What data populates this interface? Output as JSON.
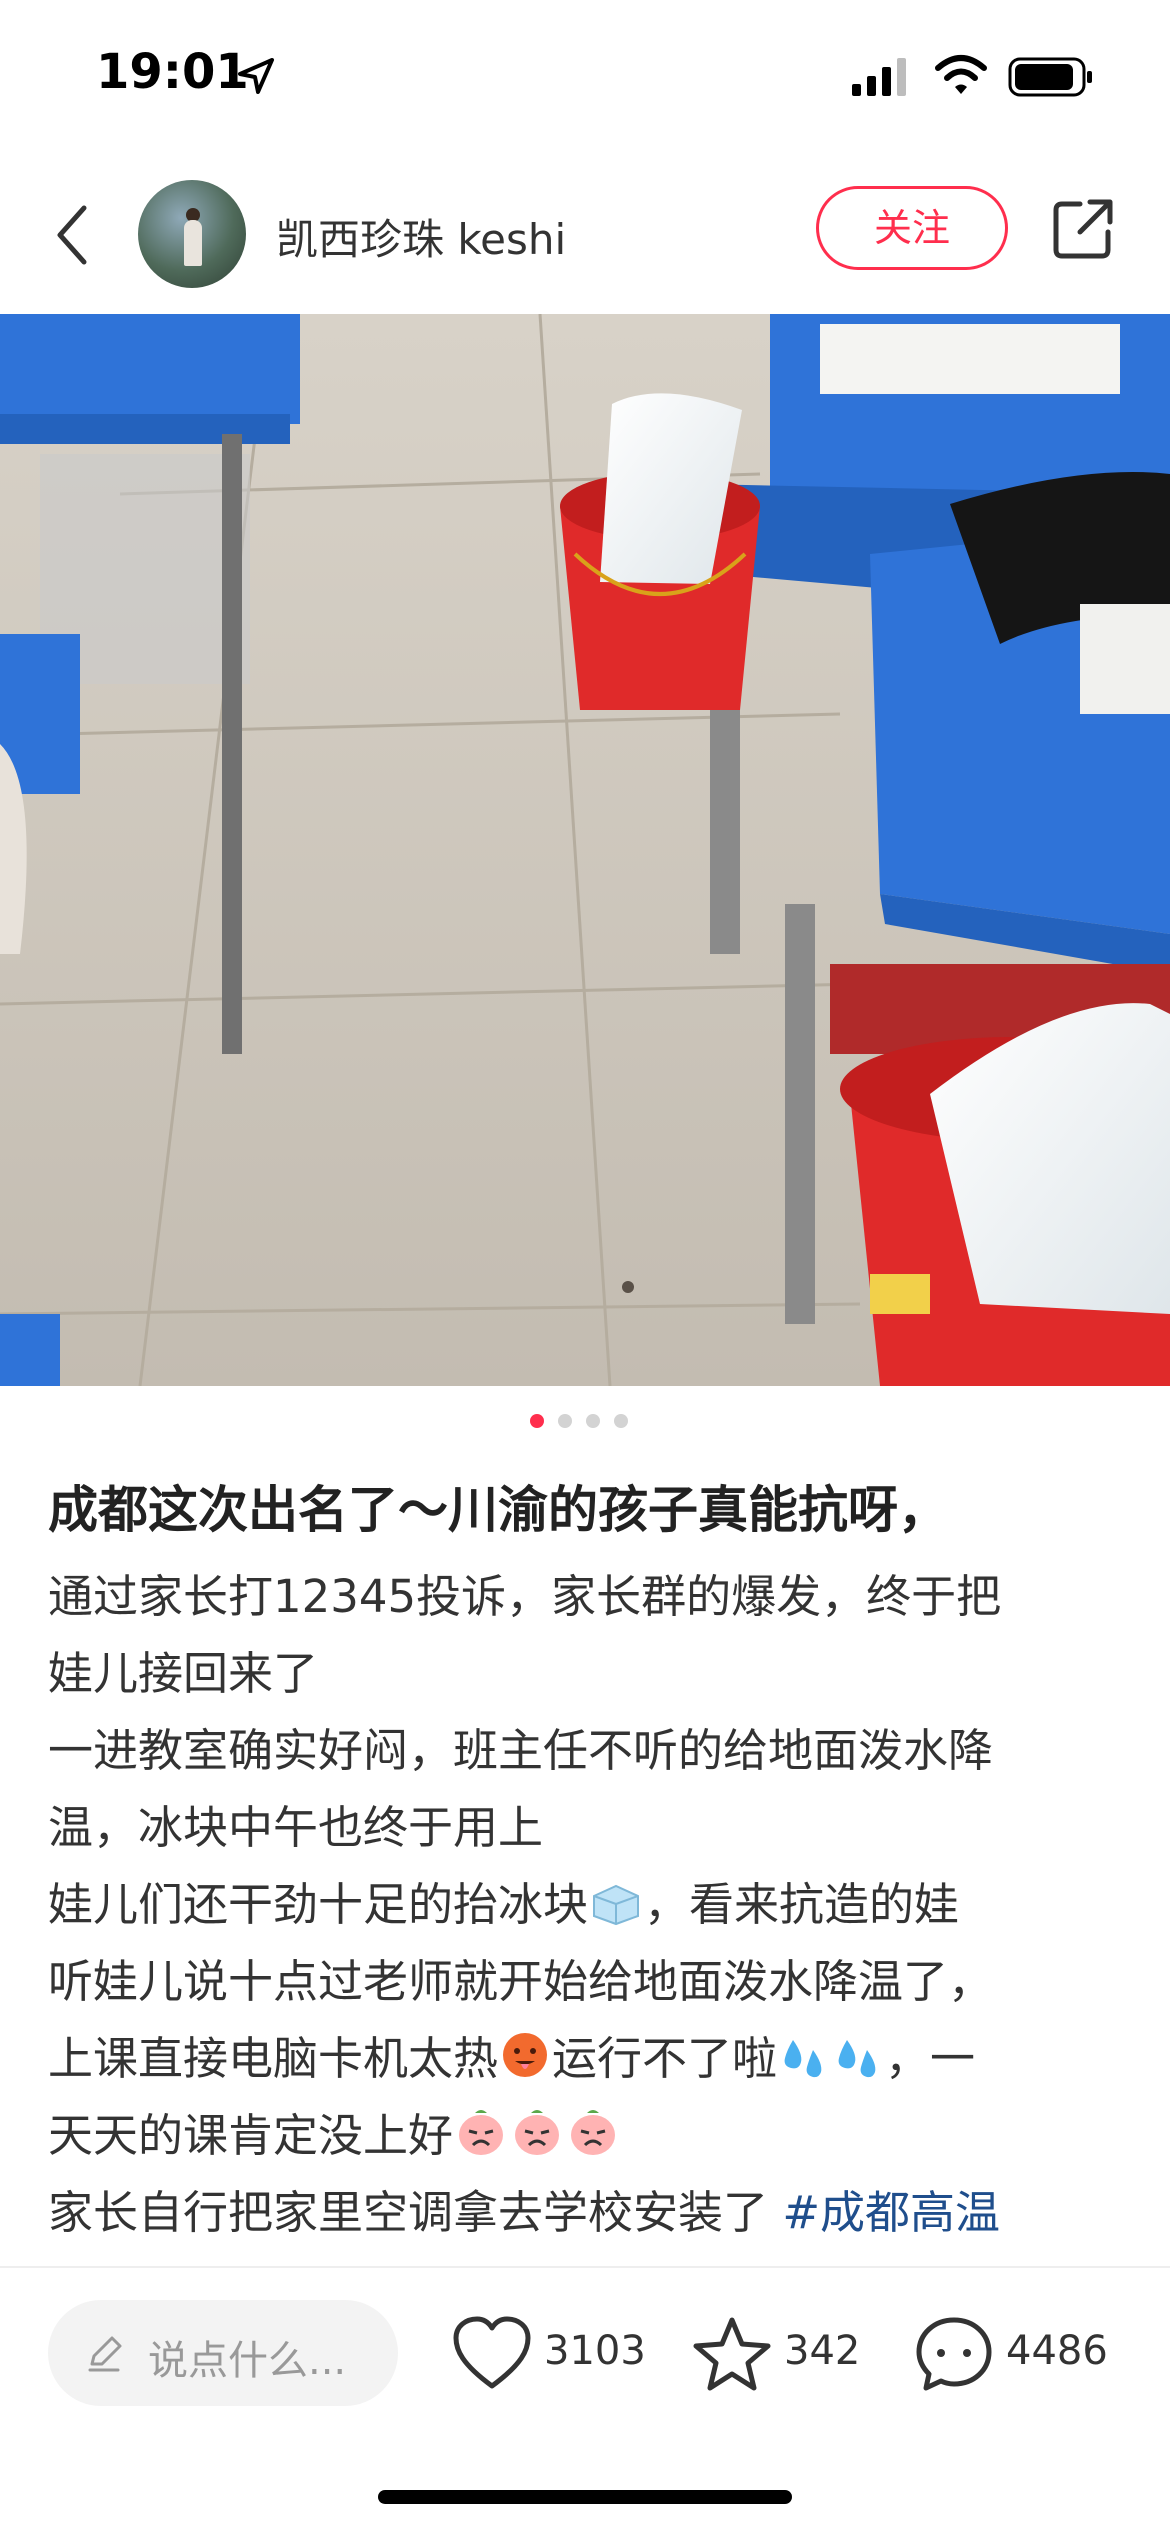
{
  "status_bar": {
    "time": "19:01",
    "icons": [
      "location-arrow-icon",
      "cellular-signal-icon",
      "wifi-icon",
      "battery-icon"
    ]
  },
  "header": {
    "author": "凯西珍珠 keshi",
    "follow_label": "关注",
    "icons": [
      "back-chevron-icon",
      "share-icon"
    ]
  },
  "carousel": {
    "total": 4,
    "current": 1
  },
  "post": {
    "title": "成都这次出名了～川渝的孩子真能抗呀，",
    "lines": [
      "通过家长打12345投诉，家长群的爆发，终于把",
      "娃儿接回来了",
      "一进教室确实好闷，班主任不听的给地面泼水降",
      "温，冰块中午也终于用上",
      "娃儿们还干劲十足的抬冰块",
      "，看来抗造的娃",
      "听娃儿说十点过老师就开始给地面泼水降温了，",
      "上课直接电脑卡机太热",
      "运行不了啦",
      "，一",
      "天天的课肯定没上好",
      "家长自行把家里空调拿去学校安装了",
      "#成都高温"
    ]
  },
  "bottom_bar": {
    "comment_placeholder": "说点什么...",
    "likes": "3103",
    "collects": "342",
    "comments": "4486"
  },
  "colors": {
    "accent": "#ff2e4d",
    "hashtag": "#1f4e8c",
    "desk_blue": "#2f73d8",
    "bucket_red": "#e02a2a"
  }
}
